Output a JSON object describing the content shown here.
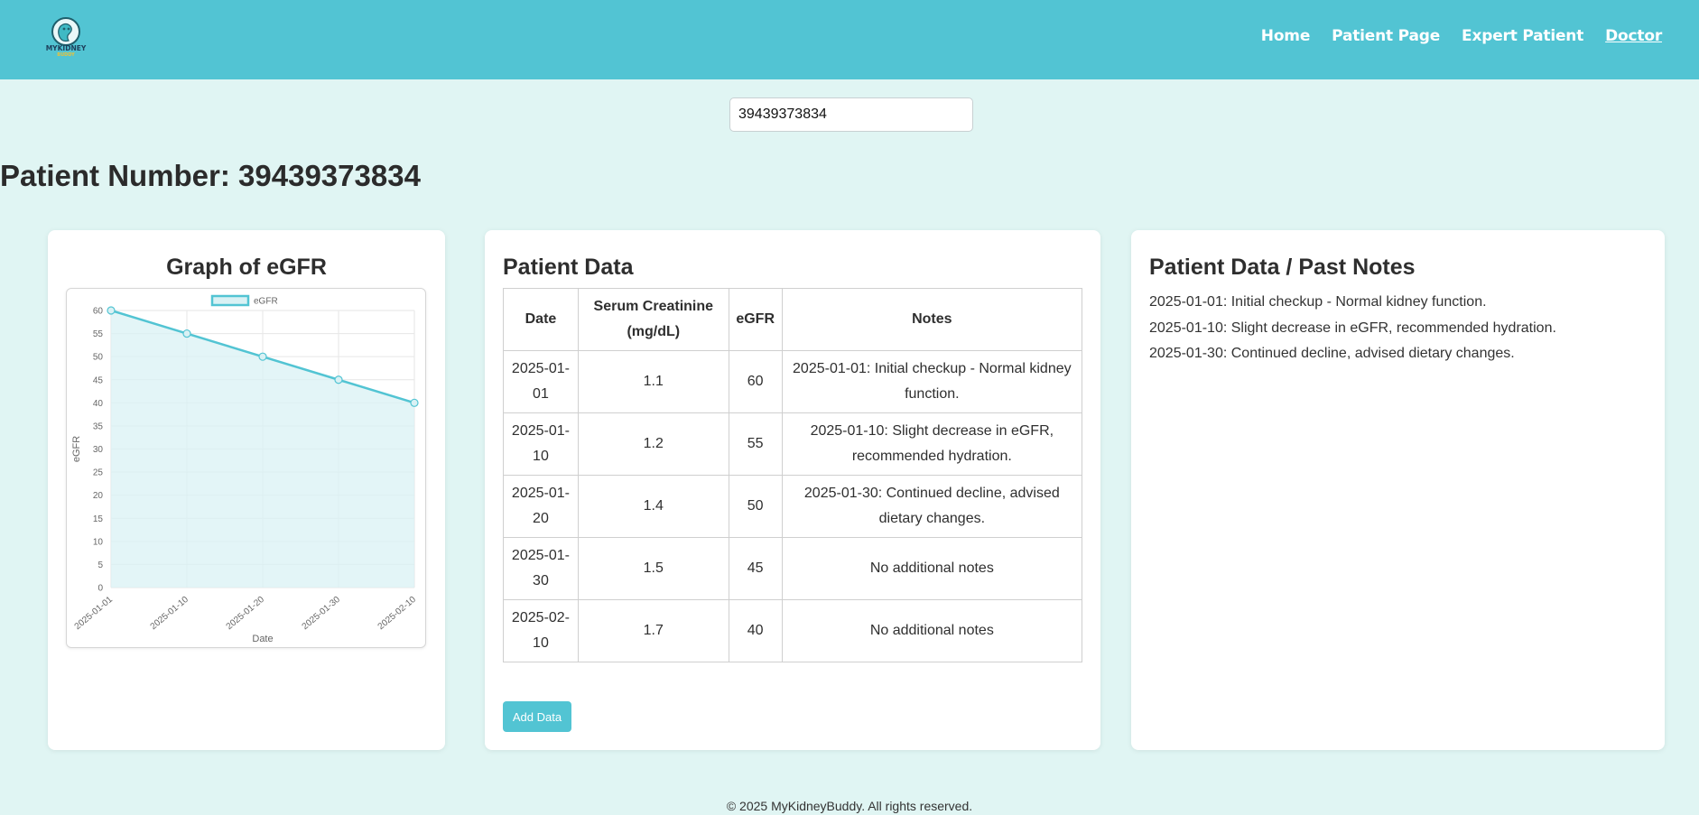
{
  "header": {
    "logo_text": "MYKIDNEY BUDDY",
    "nav": [
      {
        "label": "Home"
      },
      {
        "label": "Patient Page"
      },
      {
        "label": "Expert Patient"
      },
      {
        "label": "Doctor"
      }
    ],
    "active_nav": "Doctor",
    "brand_color": "#52c4d3"
  },
  "search": {
    "value": "39439373834"
  },
  "patient": {
    "title": "Patient Number: 39439373834"
  },
  "graph_card": {
    "title": "Graph of eGFR"
  },
  "chart_data": {
    "type": "line",
    "x": [
      "2025-01-01",
      "2025-01-10",
      "2025-01-20",
      "2025-01-30",
      "2025-02-10"
    ],
    "series": [
      {
        "name": "eGFR",
        "values": [
          60,
          55,
          50,
          45,
          40
        ]
      }
    ],
    "xlabel": "Date",
    "ylabel": "eGFR",
    "ylim": [
      0,
      60
    ],
    "yticks": [
      0,
      5,
      10,
      15,
      20,
      25,
      30,
      35,
      40,
      45,
      50,
      55,
      60
    ],
    "grid": true,
    "legend": "top",
    "fill": true,
    "line_color": "#52c4d3",
    "fill_color": "#d9f1f4"
  },
  "data_card": {
    "title": "Patient Data",
    "columns": [
      "Date",
      "Serum Creatinine (mg/dL)",
      "eGFR",
      "Notes"
    ],
    "rows": [
      [
        "2025-01-01",
        "1.1",
        "60",
        "2025-01-01: Initial checkup - Normal kidney function."
      ],
      [
        "2025-01-10",
        "1.2",
        "55",
        "2025-01-10: Slight decrease in eGFR, recommended hydration."
      ],
      [
        "2025-01-20",
        "1.4",
        "50",
        "2025-01-30: Continued decline, advised dietary changes."
      ],
      [
        "2025-01-30",
        "1.5",
        "45",
        "No additional notes"
      ],
      [
        "2025-02-10",
        "1.7",
        "40",
        "No additional notes"
      ]
    ],
    "add_button": "Add Data"
  },
  "notes_card": {
    "title": "Patient Data / Past Notes",
    "notes": [
      "2025-01-01: Initial checkup - Normal kidney function.",
      "2025-01-10: Slight decrease in eGFR, recommended hydration.",
      "2025-01-30: Continued decline, advised dietary changes."
    ]
  },
  "footer": {
    "text": "© 2025 MyKidneyBuddy. All rights reserved."
  }
}
